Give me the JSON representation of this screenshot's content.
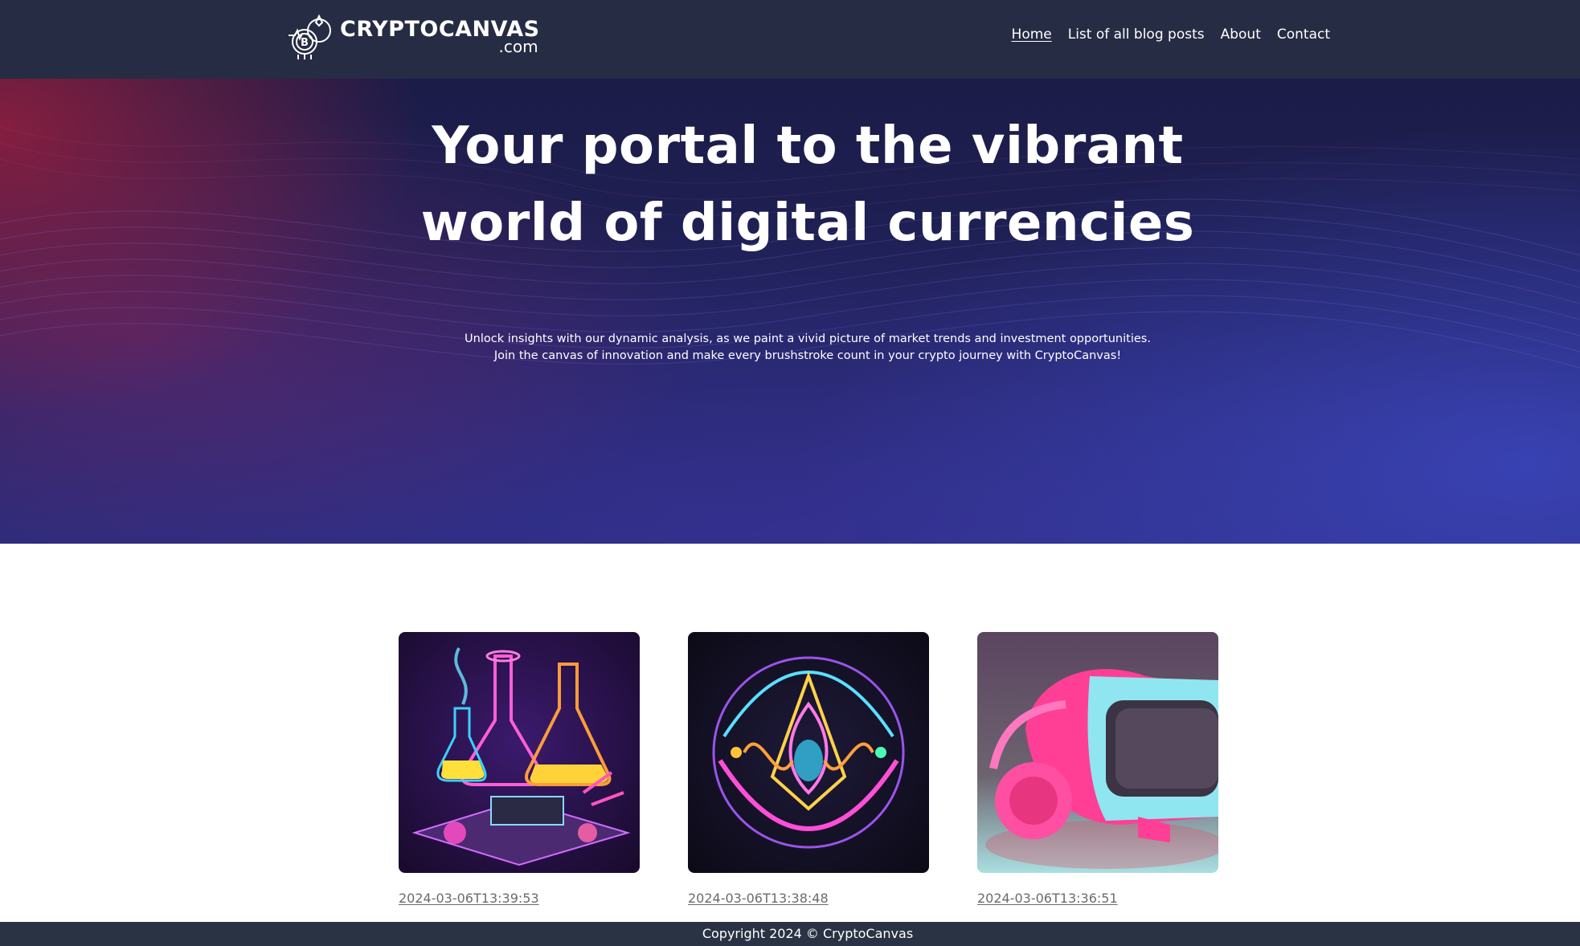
{
  "header": {
    "logo": {
      "name": "CRYPTOCANVAS",
      "domain": ".com"
    },
    "nav": [
      {
        "label": "Home",
        "active": true
      },
      {
        "label": "List of all blog posts",
        "active": false
      },
      {
        "label": "About",
        "active": false
      },
      {
        "label": "Contact",
        "active": false
      }
    ]
  },
  "hero": {
    "title_line1": "Your portal to the vibrant",
    "title_line2": "world of digital currencies",
    "subtitle_line1": "Unlock insights with our dynamic analysis, as we paint a vivid picture of market trends and investment opportunities.",
    "subtitle_line2": "Join the canvas of innovation and make every brushstroke count in your crypto journey with CryptoCanvas!"
  },
  "posts": [
    {
      "date": "2024-03-06T13:39:53",
      "image": "neon-chemistry-lab-illustration"
    },
    {
      "date": "2024-03-06T13:38:48",
      "image": "neon-abstract-orb-illustration"
    },
    {
      "date": "2024-03-06T13:36:51",
      "image": "neon-vr-headset-illustration"
    }
  ],
  "footer": {
    "copyright": "Copyright 2024 © CryptoCanvas"
  },
  "colors": {
    "header_bg": "#262c44",
    "footer_bg": "#2a3344",
    "hero_red": "#961e3c",
    "hero_blue": "#3c46be",
    "link_gray": "#6b6b6b"
  }
}
